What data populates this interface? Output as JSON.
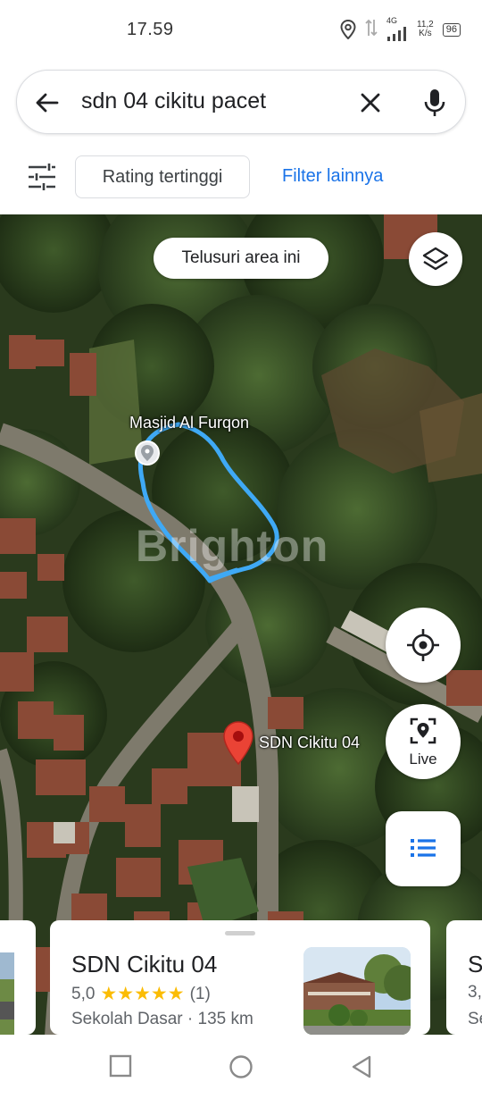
{
  "status_bar": {
    "time": "17.59",
    "network_type": "4G",
    "speed_value": "11,2",
    "speed_unit": "K/s",
    "battery": "96"
  },
  "search": {
    "query": "sdn 04 cikitu pacet"
  },
  "filters": {
    "rating_chip": "Rating tertinggi",
    "more_filters": "Filter lainnya"
  },
  "map": {
    "search_area_button": "Telusuri area ini",
    "poi_mosque": "Masjid Al Furqon",
    "poi_school": "SDN Cikitu 04",
    "watermark": "Brighton",
    "live_label": "Live",
    "pin_color": "#ea4335",
    "outline_color": "#3fa9f5"
  },
  "results": {
    "main": {
      "title": "SDN Cikitu 04",
      "rating": "5,0",
      "stars": "★★★★★",
      "review_count": "(1)",
      "category_distance": "Sekolah Dasar · 135 km"
    },
    "peek_right": {
      "title_partial": "S",
      "rating_partial": "3,",
      "category_partial": "Se"
    }
  },
  "colors": {
    "accent": "#1a73e8",
    "star": "#fbbc04"
  }
}
